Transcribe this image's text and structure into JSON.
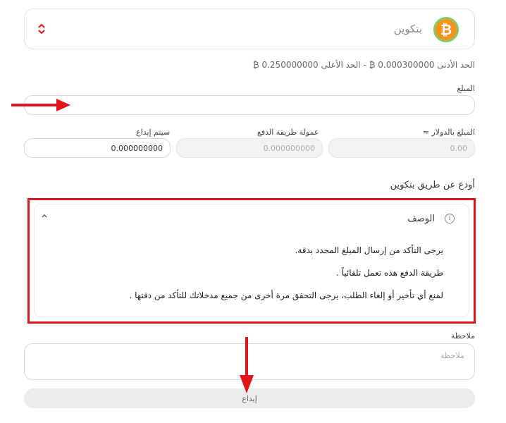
{
  "currency": {
    "name": "بتكوين",
    "icon": "bitcoin-icon",
    "symbol": "₿"
  },
  "limits": {
    "text": "الحد الأدنى 0.000300000 ₿  -  الحد الأعلى 0.250000000 ₿"
  },
  "amount": {
    "label": "المبلغ",
    "value": ""
  },
  "amount_usd": {
    "label": "المبلغ بالدولار ≈",
    "value": "0.00"
  },
  "fee": {
    "label": "عمولة طريقة الدفع",
    "value": "0.000000000"
  },
  "to_deposit": {
    "label": "سيتم إيداع",
    "value": "0.000000000"
  },
  "deposit_via": "أودع عن طريق بتكوين",
  "description": {
    "title": "الوصف",
    "lines": [
      "يرجى التأكد من إرسال المبلغ المحدد بدقة.",
      "طريقة الدفع هذه تعمل تلقائياً .",
      "لمنع أي تأخير أو إلغاء الطلب، يرجى التحقق مرة أخرى من جميع مدخلاتك للتأكد من دقتها ."
    ]
  },
  "note": {
    "label": "ملاحظة",
    "placeholder": "ملاحظة"
  },
  "deposit_button": "إيداع",
  "colors": {
    "highlight": "#e0161b",
    "bitcoin": "#f7931a"
  }
}
